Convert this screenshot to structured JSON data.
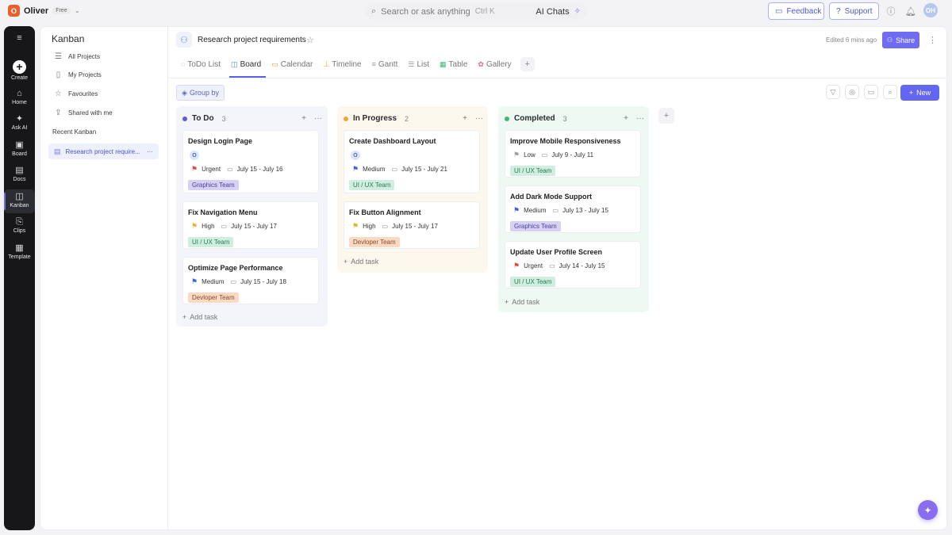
{
  "topbar": {
    "user_initial": "O",
    "user_name": "Oliver",
    "plan": "Free",
    "search_placeholder": "Search or ask anything",
    "search_shortcut": "Ctrl K",
    "ai_chats_label": "AI Chats",
    "feedback_label": "Feedback",
    "support_label": "Support",
    "avatar_initials": "OH"
  },
  "rail": {
    "items": [
      {
        "label": "Create"
      },
      {
        "label": "Home"
      },
      {
        "label": "Ask AI"
      },
      {
        "label": "Board"
      },
      {
        "label": "Docs"
      },
      {
        "label": "Kanban"
      },
      {
        "label": "Clips"
      },
      {
        "label": "Template"
      }
    ]
  },
  "sidebar": {
    "title": "Kanban",
    "items": [
      {
        "label": "All Projects"
      },
      {
        "label": "My Projects"
      },
      {
        "label": "Favourites"
      },
      {
        "label": "Shared with me"
      }
    ],
    "recent_section": "Recent Kanban",
    "recent_item": "Research project require...",
    "recent_more": "···"
  },
  "header": {
    "project_title": "Research project requirements",
    "edited": "Edited 6 mins ago",
    "share_label": "Share"
  },
  "tabs": [
    {
      "label": "ToDo List"
    },
    {
      "label": "Board"
    },
    {
      "label": "Calendar"
    },
    {
      "label": "Timeline"
    },
    {
      "label": "Gantt"
    },
    {
      "label": "List"
    },
    {
      "label": "Table"
    },
    {
      "label": "Gallery"
    }
  ],
  "toolbar": {
    "group_by_label": "Group by",
    "new_label": "New"
  },
  "board": {
    "add_task_label": "Add task",
    "colors": {
      "todo": "#5b5fd6",
      "progress": "#f0a43a",
      "done": "#3fb87a",
      "urgent": "#e04848",
      "high": "#e5b11d",
      "medium": "#3f5fe0",
      "low": "#9a9aa0"
    },
    "columns": [
      {
        "title": "To Do",
        "count": "3",
        "cards": [
          {
            "title": "Design Login Page",
            "assignee": "O",
            "priority": "Urgent",
            "dates": "July 15 - July 16",
            "tag": "Graphics Team"
          },
          {
            "title": "Fix Navigation Menu",
            "priority": "High",
            "dates": "July 15 - July 17",
            "tag": "UI / UX Team"
          },
          {
            "title": "Optimize Page Performance",
            "priority": "Medium",
            "dates": "July 15 - July 18",
            "tag": "Devloper Team"
          }
        ]
      },
      {
        "title": "In Progress",
        "count": "2",
        "cards": [
          {
            "title": "Create Dashboard Layout",
            "assignee": "O",
            "priority": "Medium",
            "dates": "July 15 - July 21",
            "tag": "UI / UX Team"
          },
          {
            "title": "Fix Button Alignment",
            "priority": "High",
            "dates": "July 15 - July 17",
            "tag": "Devloper Team"
          }
        ]
      },
      {
        "title": "Completed",
        "count": "3",
        "cards": [
          {
            "title": "Improve Mobile Responsiveness",
            "priority": "Low",
            "dates": "July 9 - July 11",
            "tag": "UI / UX Team"
          },
          {
            "title": "Add Dark Mode Support",
            "priority": "Medium",
            "dates": "July 13 - July 15",
            "tag": "Graphics Team"
          },
          {
            "title": "Update User Profile Screen",
            "priority": "Urgent",
            "dates": "July 14 - July 15",
            "tag": "UI / UX Team"
          }
        ]
      }
    ]
  }
}
